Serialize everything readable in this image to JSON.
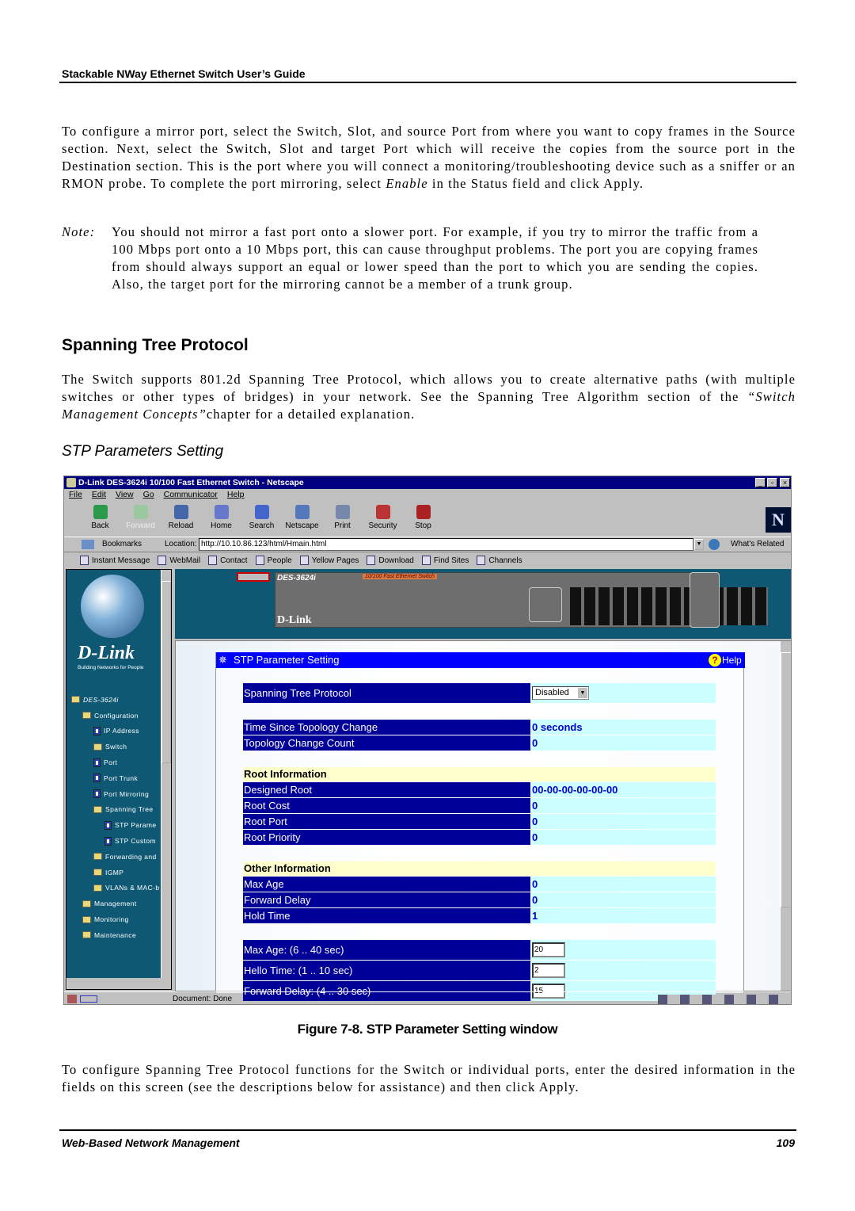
{
  "header": {
    "title": "Stackable NWay Ethernet Switch User’s Guide"
  },
  "intro": "To configure a mirror port, select the Switch, Slot, and source Port from where you want to copy frames in the Source section. Next, select the Switch, Slot and target Port which will receive the copies from the source port in the Destination section. This is the port where you will connect a monitoring/troubleshooting device such as a sniffer or an RMON probe. To complete the port mirroring, select ",
  "intro_em": "Enable",
  "intro_end": " in the Status field and click Apply.",
  "note_label": "Note:",
  "note": "You should not mirror a fast port onto a slower port. For example, if you try to mirror the traffic from a 100 Mbps port onto a 10 Mbps port, this can cause throughput problems. The port you are copying frames from should always support an equal or lower speed than the port to which you are sending the copies. Also, the target port for the mirroring cannot be a member of a trunk group.",
  "section_title": "Spanning Tree Protocol",
  "section_text": "The Switch supports 801.2d Spanning Tree Protocol, which allows you to create alternative paths (with multiple switches or other types of bridges) in your network. See the Spanning Tree Algorithm section of the ",
  "section_em": "“Switch Management Concepts”",
  "section_end": "chapter for a detailed explanation.",
  "subsection_title": "STP Parameters Setting",
  "browser": {
    "title": "D-Link DES-3624i 10/100 Fast Ethernet Switch - Netscape",
    "menu": [
      "File",
      "Edit",
      "View",
      "Go",
      "Communicator",
      "Help"
    ],
    "toolbar": [
      "Back",
      "Forward",
      "Reload",
      "Home",
      "Search",
      "Netscape",
      "Print",
      "Security",
      "Stop"
    ],
    "bookmarks": "Bookmarks",
    "location_label": "Location:",
    "url": "http://10.10.86.123/html/Hmain.html",
    "whats_related": "What's Related",
    "personal": [
      "Instant Message",
      "WebMail",
      "Contact",
      "People",
      "Yellow Pages",
      "Download",
      "Find Sites",
      "Channels"
    ],
    "logo": "D-Link",
    "logo_tag": "Building Networks for People",
    "tree": [
      {
        "label": "DES-3624i",
        "level": 0,
        "icon": "folder-open"
      },
      {
        "label": "Configuration",
        "level": 1,
        "icon": "folder-open"
      },
      {
        "label": "IP Address",
        "level": 2,
        "icon": "page"
      },
      {
        "label": "Switch",
        "level": 2,
        "icon": "folder"
      },
      {
        "label": "Port",
        "level": 2,
        "icon": "page"
      },
      {
        "label": "Port Trunk",
        "level": 2,
        "icon": "page"
      },
      {
        "label": "Port Mirroring",
        "level": 2,
        "icon": "page"
      },
      {
        "label": "Spanning Tree",
        "level": 2,
        "icon": "folder-open"
      },
      {
        "label": "STP Parame",
        "level": 3,
        "icon": "page"
      },
      {
        "label": "STP Custom",
        "level": 3,
        "icon": "page"
      },
      {
        "label": "Forwarding and",
        "level": 2,
        "icon": "folder"
      },
      {
        "label": "IGMP",
        "level": 2,
        "icon": "folder"
      },
      {
        "label": "VLANs & MAC-b",
        "level": 2,
        "icon": "folder"
      },
      {
        "label": "Management",
        "level": 1,
        "icon": "folder"
      },
      {
        "label": "Monitoring",
        "level": 1,
        "icon": "folder"
      },
      {
        "label": "Maintenance",
        "level": 1,
        "icon": "folder"
      }
    ],
    "device_model": "DES-3624i",
    "device_desc": "10/100 Fast Ethernet Switch",
    "device_brand": "D-Link",
    "panel": {
      "title": "STP Parameter Setting",
      "help": "Help",
      "stp_label": "Spanning Tree Protocol",
      "stp_value": "Disabled",
      "time_label": "Time Since Topology Change",
      "time_value": "0 seconds",
      "count_label": "Topology Change Count",
      "count_value": "0",
      "root_header": "Root Information",
      "root": [
        {
          "label": "Designed Root",
          "value": "00-00-00-00-00-00"
        },
        {
          "label": "Root Cost",
          "value": "0"
        },
        {
          "label": "Root Port",
          "value": "0"
        },
        {
          "label": "Root Priority",
          "value": "0"
        }
      ],
      "other_header": "Other Information",
      "other": [
        {
          "label": "Max Age",
          "value": "0"
        },
        {
          "label": "Forward Delay",
          "value": "0"
        },
        {
          "label": "Hold Time",
          "value": "1"
        }
      ],
      "inputs": [
        {
          "label": "Max Age: (6 .. 40 sec)",
          "value": "20"
        },
        {
          "label": "Hello Time: (1 .. 10 sec)",
          "value": "2"
        },
        {
          "label": "Forward Delay: (4 .. 30 sec)",
          "value": "15"
        }
      ]
    },
    "status": "Document: Done"
  },
  "caption": "Figure 7-8.  STP Parameter Setting window",
  "outro": "To configure Spanning Tree Protocol functions for the Switch or individual ports, enter the desired information in the fields on this screen (see the descriptions below for assistance) and then click Apply.",
  "footer": {
    "left": "Web-Based Network Management",
    "page": "109"
  }
}
